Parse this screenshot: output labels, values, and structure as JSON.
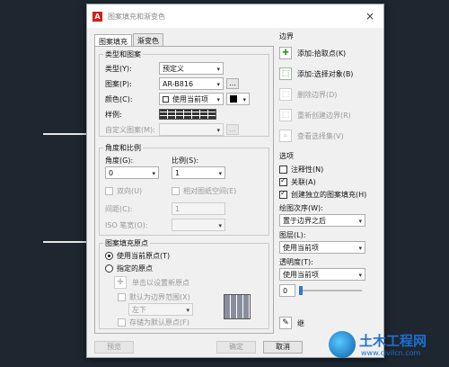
{
  "dialog": {
    "title": "图案填充和渐变色",
    "close_symbol": "×"
  },
  "tabs": [
    {
      "label": "图案填充"
    },
    {
      "label": "渐变色"
    }
  ],
  "type_pattern": {
    "title": "类型和图案",
    "type_label": "类型(Y):",
    "type_value": "预定义",
    "pattern_label": "图案(P):",
    "pattern_value": "AR-B816",
    "color_label": "颜色(C):",
    "color_value": "使用当前项",
    "sample_label": "样例:",
    "custom_label": "自定义图案(M):"
  },
  "angle_scale": {
    "title": "角度和比例",
    "angle_label": "角度(G):",
    "angle_value": "0",
    "scale_label": "比例(S):",
    "scale_value": "1",
    "double_label": "双向(U)",
    "relative_label": "相对图纸空间(E)",
    "spacing_label": "间距(C):",
    "spacing_value": "1",
    "iso_label": "ISO 笔宽(O):"
  },
  "origin": {
    "title": "图案填充原点",
    "use_current_label": "使用当前原点(T)",
    "specified_label": "指定的原点",
    "click_set_label": "单击以设置新原点",
    "default_extent_label": "默认为边界范围(X)",
    "extent_value": "左下",
    "store_default_label": "存储为默认原点(F)"
  },
  "boundaries": {
    "title": "边界",
    "add_pick_label": "添加:拾取点(K)",
    "add_select_label": "添加:选择对象(B)",
    "remove_label": "删除边界(D)",
    "recreate_label": "重新创建边界(R)",
    "view_label": "查看选择集(V)"
  },
  "options": {
    "title": "选项",
    "annotative_label": "注释性(N)",
    "associative_label": "关联(A)",
    "separate_label": "创建独立的图案填充(H)",
    "draw_order_label": "绘图次序(W):",
    "draw_order_value": "置于边界之后",
    "layer_label": "图层(L):",
    "layer_value": "使用当前项",
    "transparency_label": "透明度(T):",
    "transparency_value": "使用当前项",
    "transparency_number": "0"
  },
  "inherit_label": "继",
  "footer": {
    "preview_label": "预览",
    "ok_label": "确定",
    "cancel_label": "取消"
  },
  "watermark": {
    "brand": "土木工程网",
    "url": "www.civilcn.com"
  }
}
